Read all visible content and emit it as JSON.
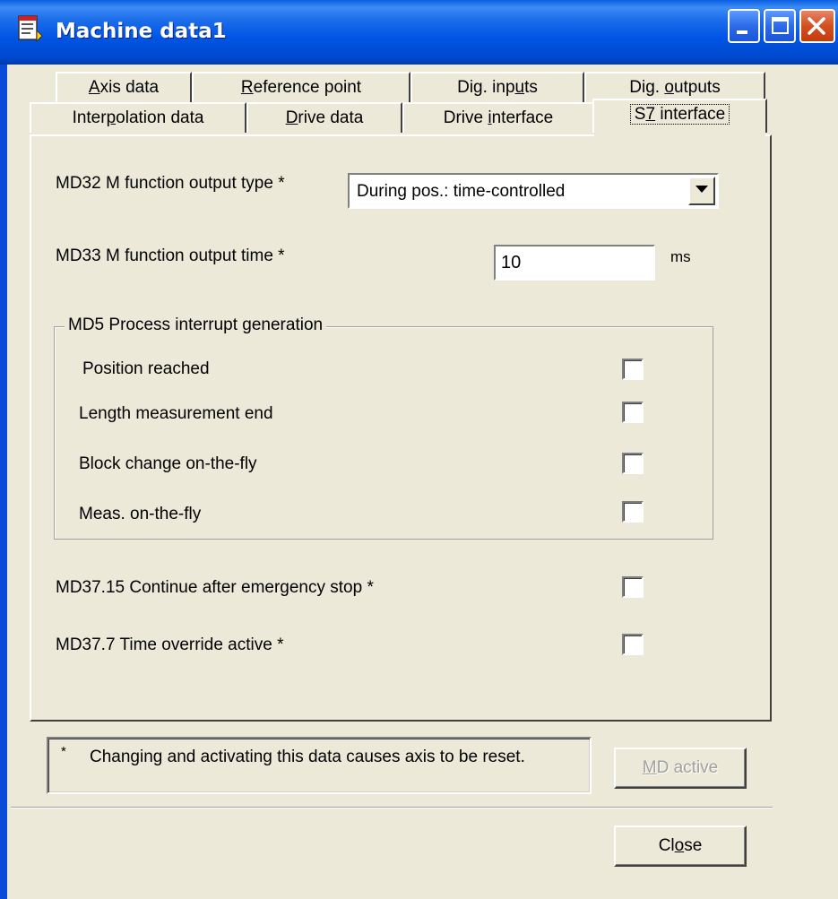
{
  "window": {
    "title": "Machine data1",
    "icon": "document-icon",
    "buttons": [
      "minimize-icon",
      "maximize-icon",
      "close-icon"
    ]
  },
  "tabs": {
    "row_back": [
      {
        "label": "Axis data",
        "mnemonic": "A"
      },
      {
        "label": "Reference point",
        "mnemonic": "R"
      },
      {
        "label": "Dig. inputs",
        "mnemonic": "u"
      },
      {
        "label": "Dig. outputs",
        "mnemonic": "o"
      }
    ],
    "row_front": [
      {
        "label": "Interpolation data",
        "mnemonic": "p"
      },
      {
        "label": "Drive data",
        "mnemonic": "D"
      },
      {
        "label": "Drive interface",
        "mnemonic": "i"
      },
      {
        "label": "S7 interface",
        "mnemonic": "7",
        "selected": true
      }
    ]
  },
  "fields": {
    "md32_label": "MD32 M function output type *",
    "md32_value": "During pos.: time-controlled",
    "md33_label": "MD33 M function output time *",
    "md33_value": "10",
    "md33_unit": "ms"
  },
  "group": {
    "title": "MD5 Process interrupt generation",
    "items": [
      {
        "label": "Position reached",
        "checked": false
      },
      {
        "label": "Length measurement end",
        "checked": false
      },
      {
        "label": "Block change on-the-fly",
        "checked": false
      },
      {
        "label": "Meas. on-the-fly",
        "checked": false
      }
    ]
  },
  "options": [
    {
      "label": "MD37.15 Continue after emergency stop *",
      "checked": false
    },
    {
      "label": "MD37.7 Time override active *",
      "checked": false
    }
  ],
  "note": {
    "star": "*",
    "text": "Changing and activating this data causes axis to be reset."
  },
  "buttons": {
    "md_active": "MD active",
    "md_active_mnemonic": "M",
    "close": "Close",
    "close_mnemonic": "o"
  }
}
